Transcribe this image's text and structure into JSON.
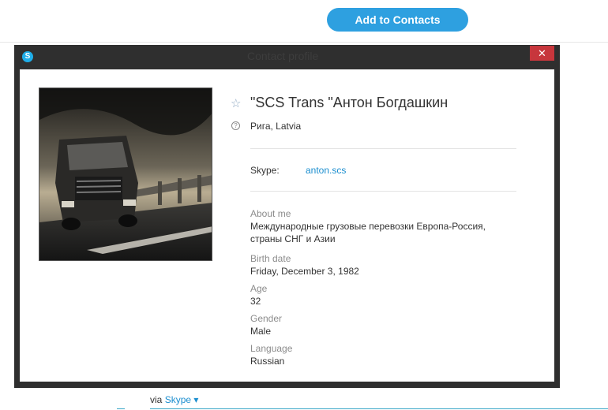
{
  "header": {
    "add_contacts_label": "Add to Contacts"
  },
  "window": {
    "title": "Contact profile",
    "close_glyph": "✕",
    "logo_glyph": "S"
  },
  "profile": {
    "name": "\"SCS Trans \"Антон Богдашкин",
    "location": "Рига, Latvia",
    "skype_label": "Skype:",
    "skype_name": "anton.scs",
    "about_label": "About me",
    "about_value": "Международные грузовые перевозки Европа-Россия, страны СНГ и Азии",
    "birth_label": "Birth date",
    "birth_value": "Friday, December 3, 1982",
    "age_label": "Age",
    "age_value": "32",
    "gender_label": "Gender",
    "gender_value": "Male",
    "language_label": "Language",
    "language_value": "Russian"
  },
  "footer": {
    "via_label": "via",
    "via_link": "Skype"
  },
  "icons": {
    "favorite": "star-icon",
    "location": "location-icon",
    "dropdown": "caret-down-icon"
  },
  "colors": {
    "accent": "#2ea0e0",
    "link": "#1b8ecf",
    "close": "#c7363c",
    "window_frame": "#2f2f2f"
  }
}
